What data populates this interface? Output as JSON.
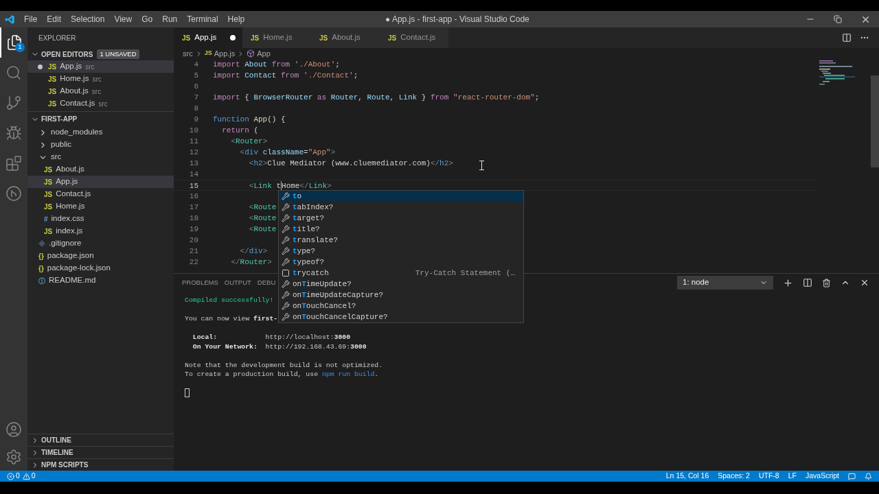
{
  "title_bar": {
    "menus": [
      "File",
      "Edit",
      "Selection",
      "View",
      "Go",
      "Run",
      "Terminal",
      "Help"
    ],
    "title": "● App.js - first-app - Visual Studio Code"
  },
  "activity_bar": {
    "badge": "1",
    "items": [
      {
        "kind": "files",
        "selected": true
      },
      {
        "kind": "search",
        "selected": false
      },
      {
        "kind": "source-control",
        "selected": false
      },
      {
        "kind": "run",
        "selected": false
      },
      {
        "kind": "extensions",
        "selected": false
      },
      {
        "kind": "remote",
        "selected": false
      }
    ],
    "bottom": [
      {
        "kind": "account"
      },
      {
        "kind": "settings"
      }
    ]
  },
  "sidebar": {
    "header": "EXPLORER",
    "open_editors": {
      "title": "OPEN EDITORS",
      "badge": "1 UNSAVED",
      "expanded": true,
      "items": [
        {
          "name": "App.js",
          "folder": "src",
          "glyph": "JS",
          "kind": "js",
          "dirty": true,
          "selected": true
        },
        {
          "name": "Home.js",
          "folder": "src",
          "glyph": "JS",
          "kind": "js",
          "dirty": false,
          "selected": false
        },
        {
          "name": "About.js",
          "folder": "src",
          "glyph": "JS",
          "kind": "js",
          "dirty": false,
          "selected": false
        },
        {
          "name": "Contact.js",
          "folder": "src",
          "glyph": "JS",
          "kind": "js",
          "dirty": false,
          "selected": false
        }
      ]
    },
    "project": {
      "title": "FIRST-APP",
      "expanded": true,
      "items": [
        {
          "name": "node_modules",
          "kind": "folder",
          "expanded": false,
          "selected": false
        },
        {
          "name": "public",
          "kind": "folder",
          "expanded": false,
          "selected": false
        },
        {
          "name": "src",
          "kind": "folder",
          "expanded": true,
          "selected": false,
          "children": [
            {
              "name": "About.js",
              "kind": "js",
              "glyph": "JS",
              "selected": false
            },
            {
              "name": "App.js",
              "kind": "js",
              "glyph": "JS",
              "selected": true
            },
            {
              "name": "Contact.js",
              "kind": "js",
              "glyph": "JS",
              "selected": false
            },
            {
              "name": "Home.js",
              "kind": "js",
              "glyph": "JS",
              "selected": false
            },
            {
              "name": "index.css",
              "kind": "css",
              "glyph": "#",
              "selected": false
            },
            {
              "name": "index.js",
              "kind": "js",
              "glyph": "JS",
              "selected": false
            }
          ]
        },
        {
          "name": ".gitignore",
          "kind": "git",
          "selected": false
        },
        {
          "name": "package.json",
          "kind": "json",
          "glyph": "{}",
          "selected": false
        },
        {
          "name": "package-lock.json",
          "kind": "json",
          "glyph": "{}",
          "selected": false
        },
        {
          "name": "README.md",
          "kind": "info",
          "glyph": "ⓘ",
          "selected": false
        }
      ]
    },
    "sections": [
      {
        "title": "OUTLINE",
        "expanded": false
      },
      {
        "title": "TIMELINE",
        "expanded": false
      },
      {
        "title": "NPM SCRIPTS",
        "expanded": false
      }
    ]
  },
  "tabs": [
    {
      "label": "App.js",
      "glyph": "JS",
      "selected": true,
      "dirty": true
    },
    {
      "label": "Home.js",
      "glyph": "JS",
      "selected": false,
      "dirty": false
    },
    {
      "label": "About.js",
      "glyph": "JS",
      "selected": false,
      "dirty": false
    },
    {
      "label": "Contact.js",
      "glyph": "JS",
      "selected": false,
      "dirty": false
    }
  ],
  "breadcrumb": {
    "folder": "src",
    "file_glyph": "JS",
    "file": "App.js",
    "symbol": "App"
  },
  "code": [
    {
      "number": "4",
      "current": false,
      "tokens": [
        {
          "t": "import",
          "kind": "kw"
        },
        {
          "t": " About",
          "kind": "var"
        },
        {
          "t": " from",
          "kind": "kw"
        },
        {
          "t": " './About'",
          "kind": "str"
        },
        {
          "t": ";"
        }
      ]
    },
    {
      "number": "5",
      "current": false,
      "tokens": [
        {
          "t": "import",
          "kind": "kw"
        },
        {
          "t": " Contact",
          "kind": "var"
        },
        {
          "t": " from",
          "kind": "kw"
        },
        {
          "t": " './Contact'",
          "kind": "str"
        },
        {
          "t": ";"
        }
      ]
    },
    {
      "number": "6",
      "current": false
    },
    {
      "number": "7",
      "current": false,
      "tokens": [
        {
          "t": "import",
          "kind": "kw"
        },
        {
          "t": " { "
        },
        {
          "t": "BrowserRouter",
          "kind": "var"
        },
        {
          "t": " as",
          "kind": "kw"
        },
        {
          "t": " Router",
          "kind": "var"
        },
        {
          "t": ", "
        },
        {
          "t": "Route",
          "kind": "var"
        },
        {
          "t": ", "
        },
        {
          "t": "Link",
          "kind": "var"
        },
        {
          "t": " } "
        },
        {
          "t": "from",
          "kind": "kw"
        },
        {
          "t": " \"react-router-dom\"",
          "kind": "str"
        },
        {
          "t": ";"
        }
      ]
    },
    {
      "number": "8",
      "current": false
    },
    {
      "number": "9",
      "current": false,
      "tokens": [
        {
          "t": "function",
          "kind": "storage"
        },
        {
          "t": " App",
          "kind": "func"
        },
        {
          "t": "() {"
        }
      ]
    },
    {
      "number": "10",
      "current": false,
      "tokens": [
        {
          "t": "  return",
          "kind": "kw"
        },
        {
          "t": " ("
        }
      ]
    },
    {
      "number": "11",
      "current": false,
      "tokens": [
        {
          "t": "    <",
          "kind": "punct"
        },
        {
          "t": "Router",
          "kind": "comp"
        },
        {
          "t": ">",
          "kind": "punct"
        }
      ]
    },
    {
      "number": "12",
      "current": false,
      "tokens": [
        {
          "t": "      <",
          "kind": "punct"
        },
        {
          "t": "div",
          "kind": "tag"
        },
        {
          "t": " className",
          "kind": "attr"
        },
        {
          "t": "="
        },
        {
          "t": "\"App\"",
          "kind": "str"
        },
        {
          "t": ">",
          "kind": "punct"
        }
      ]
    },
    {
      "number": "13",
      "current": false,
      "tokens": [
        {
          "t": "        <",
          "kind": "punct"
        },
        {
          "t": "h2",
          "kind": "tag"
        },
        {
          "t": ">",
          "kind": "punct"
        },
        {
          "t": "Clue Mediator (www.cluemediator.com)"
        },
        {
          "t": "</",
          "kind": "punct"
        },
        {
          "t": "h2",
          "kind": "tag"
        },
        {
          "t": ">",
          "kind": "punct"
        }
      ]
    },
    {
      "number": "14",
      "current": false
    },
    {
      "number": "15",
      "current": true,
      "tokens": [
        {
          "t": "        <",
          "kind": "punct"
        },
        {
          "t": "Link",
          "kind": "comp"
        },
        {
          "t": " t"
        },
        {
          "kind": "cursor"
        },
        {
          "t": "Home"
        },
        {
          "t": "</",
          "kind": "punct"
        },
        {
          "t": "Link",
          "kind": "comp"
        },
        {
          "t": ">",
          "kind": "punct"
        }
      ]
    },
    {
      "number": "16",
      "current": false
    },
    {
      "number": "17",
      "current": false,
      "tokens": [
        {
          "t": "        <",
          "kind": "punct"
        },
        {
          "t": "Route",
          "kind": "comp"
        }
      ]
    },
    {
      "number": "18",
      "current": false,
      "tokens": [
        {
          "t": "        <",
          "kind": "punct"
        },
        {
          "t": "Route",
          "kind": "comp"
        }
      ]
    },
    {
      "number": "19",
      "current": false,
      "tokens": [
        {
          "t": "        <",
          "kind": "punct"
        },
        {
          "t": "Route",
          "kind": "comp"
        }
      ]
    },
    {
      "number": "20",
      "current": false
    },
    {
      "number": "21",
      "current": false,
      "tokens": [
        {
          "t": "      </",
          "kind": "punct"
        },
        {
          "t": "div",
          "kind": "tag"
        },
        {
          "t": ">",
          "kind": "punct"
        }
      ]
    },
    {
      "number": "22",
      "current": false,
      "tokens": [
        {
          "t": "    </",
          "kind": "punct"
        },
        {
          "t": "Router",
          "kind": "comp"
        },
        {
          "t": ">",
          "kind": "punct"
        }
      ]
    }
  ],
  "suggestions": [
    {
      "kind": "property",
      "match": "t",
      "rest": "o",
      "selected": true
    },
    {
      "kind": "property",
      "match": "t",
      "rest": "abIndex?",
      "selected": false
    },
    {
      "kind": "property",
      "match": "t",
      "rest": "arget?",
      "selected": false
    },
    {
      "kind": "property",
      "match": "t",
      "rest": "itle?",
      "selected": false
    },
    {
      "kind": "property",
      "match": "t",
      "rest": "ranslate?",
      "selected": false
    },
    {
      "kind": "property",
      "match": "t",
      "rest": "ype?",
      "selected": false
    },
    {
      "kind": "property",
      "match": "t",
      "rest": "ypeof?",
      "selected": false
    },
    {
      "kind": "snippet",
      "match": "t",
      "rest": "rycatch",
      "detail": "Try-Catch Statement (…",
      "selected": false
    },
    {
      "kind": "property",
      "prefix": "on",
      "match": "T",
      "rest": "imeUpdate?",
      "selected": false
    },
    {
      "kind": "property",
      "prefix": "on",
      "match": "T",
      "rest": "imeUpdateCapture?",
      "selected": false
    },
    {
      "kind": "property",
      "prefix": "on",
      "match": "T",
      "rest": "ouchCancel?",
      "selected": false
    },
    {
      "kind": "property",
      "prefix": "on",
      "match": "T",
      "rest": "ouchCancelCapture?",
      "selected": false
    }
  ],
  "panel": {
    "tabs": [
      "PROBLEMS",
      "OUTPUT",
      "DEBU"
    ],
    "terminal_select": "1: node",
    "terminal": [
      [
        [
          {
            "t": "Compiled successfully!",
            "kind": "green"
          }
        ]
      ],
      [
        [
          {
            "t": "You can now view "
          },
          {
            "t": "first-",
            "kind": "bold"
          }
        ]
      ],
      [
        [
          {
            "t": "  Local:",
            "kind": "bold"
          },
          {
            "t": "            http://localhost:"
          },
          {
            "t": "3000",
            "kind": "bold"
          }
        ],
        [
          {
            "t": "  On Your Network:",
            "kind": "bold"
          },
          {
            "t": "  http://192.168.43.69:"
          },
          {
            "t": "3000",
            "kind": "bold"
          }
        ]
      ],
      [
        [
          {
            "t": "Note that the development build is not optimized."
          }
        ],
        [
          {
            "t": "To create a production build, use "
          },
          {
            "t": "npm run build",
            "kind": "link"
          },
          {
            "t": "."
          }
        ]
      ]
    ]
  },
  "status_bar": {
    "errors": "0",
    "warnings": "0",
    "items": [
      "Ln 15, Col 16",
      "Spaces: 2",
      "UTF-8",
      "LF",
      "JavaScript"
    ]
  }
}
